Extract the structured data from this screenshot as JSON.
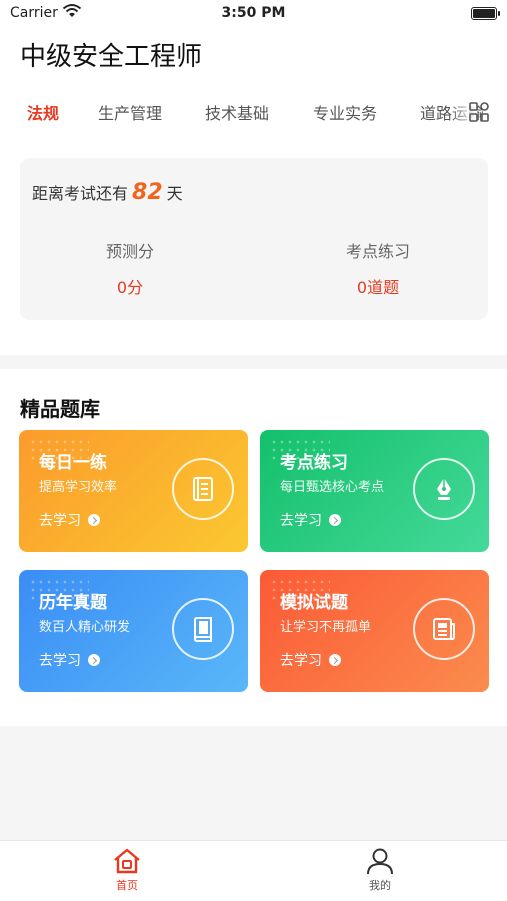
{
  "status_bar": {
    "carrier": "Carrier",
    "time": "3:50 PM"
  },
  "header": {
    "title": "中级安全工程师"
  },
  "tabs": [
    {
      "label": "法规",
      "active": true
    },
    {
      "label": "生产管理",
      "active": false
    },
    {
      "label": "技术基础",
      "active": false
    },
    {
      "label": "专业实务",
      "active": false
    },
    {
      "label": "道路运输",
      "active": false
    }
  ],
  "exam": {
    "countdown_prefix": "距离考试还有",
    "days": "82",
    "countdown_suffix": "天",
    "stats": [
      {
        "label": "预测分",
        "value": "0分"
      },
      {
        "label": "考点练习",
        "value": "0道题"
      }
    ]
  },
  "library": {
    "title": "精品题库",
    "cards": [
      {
        "title": "每日一练",
        "subtitle": "提高学习效率",
        "action": "去学习",
        "icon": "notebook-icon",
        "color": "#fb9b2c"
      },
      {
        "title": "考点练习",
        "subtitle": "每日甄选核心考点",
        "action": "去学习",
        "icon": "pen-nib-icon",
        "color": "#13c06a"
      },
      {
        "title": "历年真题",
        "subtitle": "数百人精心研发",
        "action": "去学习",
        "icon": "book-icon",
        "color": "#3a8df5"
      },
      {
        "title": "模拟试题",
        "subtitle": "让学习不再孤单",
        "action": "去学习",
        "icon": "newspaper-icon",
        "color": "#fb5a36"
      }
    ]
  },
  "tabbar": {
    "home_label": "首页",
    "mine_label": "我的"
  },
  "colors": {
    "accent": "#e8391f",
    "countdown": "#f0651e"
  }
}
